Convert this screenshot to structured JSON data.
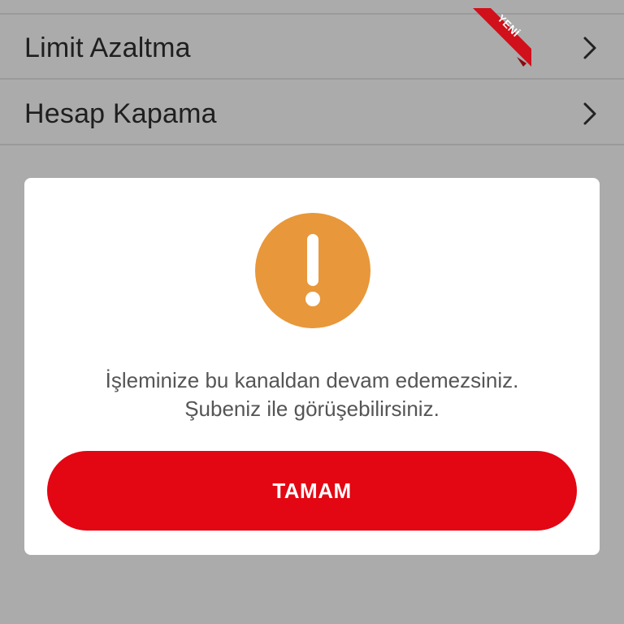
{
  "menu": {
    "items": [
      {
        "label": "Limit Azaltma",
        "badge": "YENİ",
        "chevron_icon": "chevron-right-icon"
      },
      {
        "label": "Hesap Kapama",
        "chevron_icon": "chevron-right-icon"
      }
    ]
  },
  "dialog": {
    "icon": "exclamation-icon",
    "icon_color": "#e8973a",
    "message_line1": "İşleminize bu kanaldan devam edemezsiniz.",
    "message_line2": "Şubeniz ile görüşebilirsiniz.",
    "button_label": "TAMAM",
    "button_color": "#e30613"
  },
  "colors": {
    "overlay_background": "#ababab",
    "badge_ribbon": "#d0101b"
  }
}
